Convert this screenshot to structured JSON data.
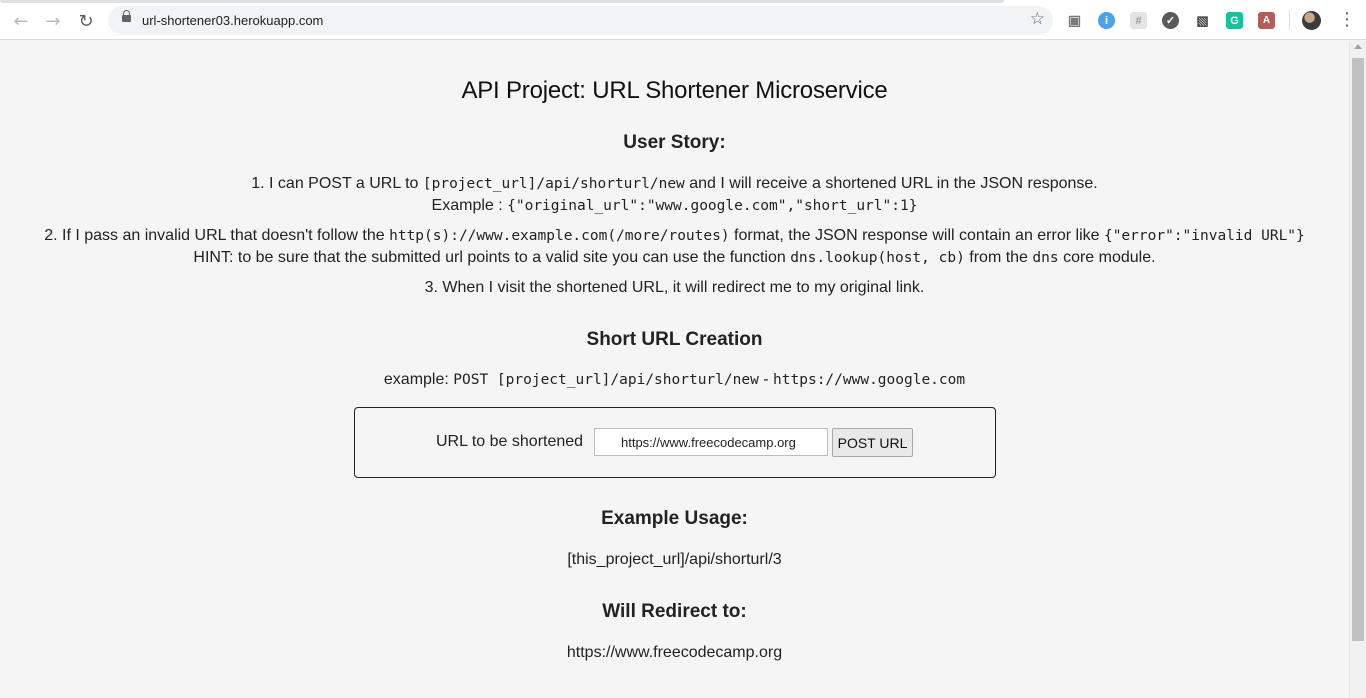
{
  "browser": {
    "url": "url-shortener03.herokuapp.com"
  },
  "page": {
    "title": "API Project: URL Shortener Microservice",
    "user_story": {
      "heading": "User Story:",
      "item1_a": "1. I can POST a URL to",
      "item1_code": "[project_url]/api/shorturl/new",
      "item1_b": "and I will receive a shortened URL in the JSON response.",
      "item1_example_label": "Example :",
      "item1_example_code": "{\"original_url\":\"www.google.com\",\"short_url\":1}",
      "item2_a": "2. If I pass an invalid URL that doesn't follow the",
      "item2_code": "http(s)://www.example.com(/more/routes)",
      "item2_b": "format, the JSON response will contain an error like",
      "item2_error_code": "{\"error\":\"invalid URL\"}",
      "hint_a": "HINT: to be sure that the submitted url points to a valid site you can use the function",
      "hint_code": "dns.lookup(host, cb)",
      "hint_b": "from the",
      "hint_module": "dns",
      "hint_c": "core module.",
      "item3": "3. When I visit the shortened URL, it will redirect me to my original link."
    },
    "creation": {
      "heading": "Short URL Creation",
      "example_label": "example:",
      "example_code1": "POST [project_url]/api/shorturl/new",
      "example_dash": "-",
      "example_code2": "https://www.google.com"
    },
    "form": {
      "label": "URL to be shortened",
      "input_value": "https://www.freecodecamp.org",
      "button_label": "POST URL"
    },
    "usage": {
      "heading": "Example Usage:",
      "text": "[this_project_url]/api/shorturl/3"
    },
    "redirect": {
      "heading": "Will Redirect to:",
      "text": "https://www.freecodecamp.org"
    }
  },
  "icons": {
    "back": "arrow-left-icon",
    "forward": "arrow-right-icon",
    "reload": "reload-icon",
    "lock": "lock-icon",
    "bookmark": "star-icon",
    "extensions": [
      "camera-icon",
      "info-icon",
      "grid-icon",
      "leaf-icon",
      "bus-icon",
      "grammarly-icon",
      "pdf-icon"
    ],
    "menu": "kebab-menu-icon"
  },
  "colors": {
    "page_background": "#f5f5f5",
    "info_extension": "#4aa3e8",
    "grammarly_extension": "#15c39a",
    "pdf_extension": "#b45d5d"
  }
}
